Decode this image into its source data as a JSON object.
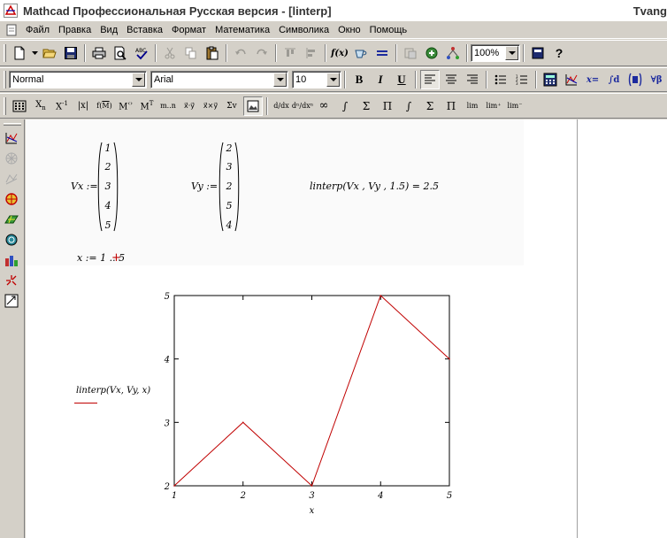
{
  "window": {
    "title": "Mathcad Профессиональная Русская версия - [linterp]",
    "title_right": "Tvang"
  },
  "menu": [
    "Файл",
    "Правка",
    "Вид",
    "Вставка",
    "Формат",
    "Математика",
    "Символика",
    "Окно",
    "Помощь"
  ],
  "toolbar": {
    "zoom": "100%",
    "style": "Normal",
    "font": "Arial",
    "size": "10",
    "bold": "B",
    "italic": "I",
    "underline": "U"
  },
  "worksheet": {
    "vx_label": "Vx :=",
    "vy_label": "Vy :=",
    "vx_values": [
      "1",
      "2",
      "3",
      "4",
      "5"
    ],
    "vy_values": [
      "2",
      "3",
      "2",
      "5",
      "4"
    ],
    "linterp_expr": "linterp(Vx , Vy , 1.5) = 2.5",
    "range_def": "x := 1 .. 5",
    "plot_legend": "linterp(Vx, Vy, x)"
  },
  "chart_data": {
    "type": "line",
    "x": [
      1,
      2,
      3,
      4,
      5
    ],
    "series": [
      {
        "name": "linterp(Vx, Vy, x)",
        "values": [
          2,
          3,
          2,
          5,
          4
        ],
        "color": "#c00000"
      }
    ],
    "xlim": [
      1,
      5
    ],
    "ylim": [
      2,
      5
    ],
    "xticks": [
      "1",
      "2",
      "3",
      "4",
      "5"
    ],
    "yticks": [
      "2",
      "3",
      "4",
      "5"
    ],
    "xlabel": "x",
    "ylabel": "",
    "title": "",
    "grid": false
  }
}
